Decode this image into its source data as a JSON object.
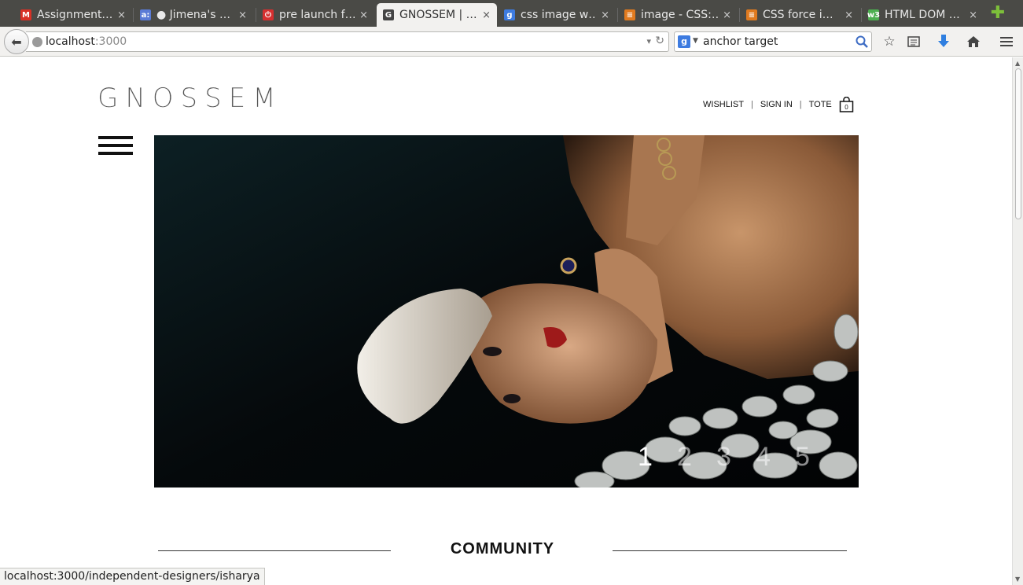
{
  "browser": {
    "tabs": [
      {
        "title": "Assignment…",
        "fav": "gmail-icon",
        "color": "#d93025",
        "glyph": "M",
        "active": false
      },
      {
        "title": "● Jimena's …",
        "fav": "asana-icon",
        "color": "#5a7bd6",
        "glyph": "a:",
        "active": false
      },
      {
        "title": "pre launch f…",
        "fav": "power-icon",
        "color": "#d62f2f",
        "glyph": "⏻",
        "active": false
      },
      {
        "title": "GNOSSEM | …",
        "fav": "gnossem-icon",
        "color": "#444444",
        "glyph": "G",
        "active": true
      },
      {
        "title": "css image w…",
        "fav": "google-icon",
        "color": "#3d7be0",
        "glyph": "g",
        "active": false
      },
      {
        "title": "image - CSS:…",
        "fav": "stackoverflow-icon",
        "color": "#e07a1f",
        "glyph": "≡",
        "active": false
      },
      {
        "title": "CSS force i…",
        "fav": "stackoverflow-icon",
        "color": "#e07a1f",
        "glyph": "≡",
        "active": false
      },
      {
        "title": "HTML DOM …",
        "fav": "w3schools-icon",
        "color": "#4caf50",
        "glyph": "w3",
        "active": false
      }
    ],
    "close_glyph": "×",
    "new_tab_glyph": "✚",
    "url_host": "localhost",
    "url_port": ":3000",
    "search_value": "anchor target",
    "search_engine_glyph": "g",
    "status_text": "localhost:3000/independent-designers/isharya"
  },
  "site": {
    "logo": "GNOSSEM",
    "nav": {
      "wishlist": "WISHLIST",
      "sign_in": "SIGN IN",
      "tote": "TOTE",
      "separator": "|",
      "tote_count": "0"
    },
    "slides": [
      "1",
      "2",
      "3",
      "4",
      "5"
    ],
    "active_slide": 1,
    "section_heading": "COMMUNITY"
  },
  "colors": {
    "chrome_dark": "#4a4a46",
    "chrome_light": "#f2f1ef",
    "hero_bg": "#05080a",
    "text": "#111111"
  }
}
